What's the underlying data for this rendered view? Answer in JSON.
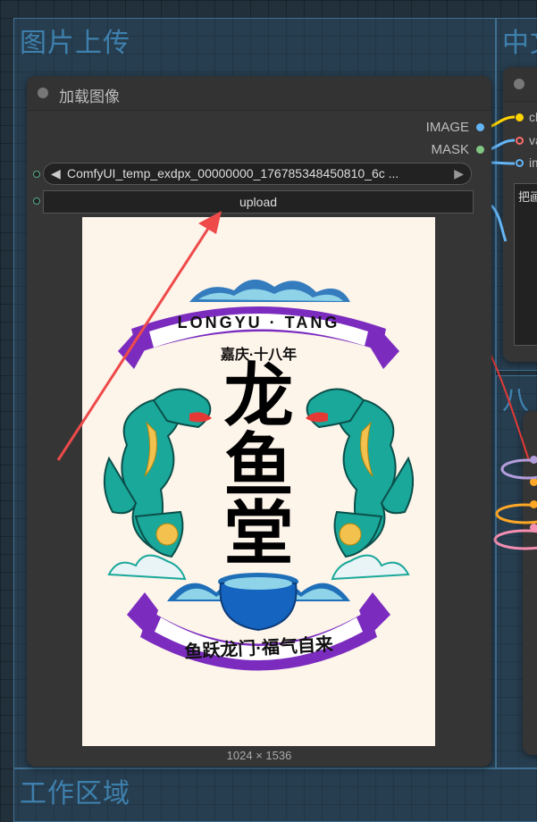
{
  "groups": {
    "upload_group_title": "图片上传",
    "chinese_group_title": "中文",
    "eight_group_title": "八",
    "workspace_group_title": "工作区域"
  },
  "load_image_node": {
    "title": "加载图像",
    "outputs": [
      {
        "label": "IMAGE",
        "color": "#64b5f6"
      },
      {
        "label": "MASK",
        "color": "#81c784"
      }
    ],
    "image_combo": {
      "value": "ComfyUI_temp_exdpx_00000000_176785348450810_6c ...",
      "left_arrow": "◀",
      "right_arrow": "▶"
    },
    "upload_label": "upload",
    "image_size": "1024 × 1536"
  },
  "poster": {
    "banner_top": "LONGYU · TANG",
    "subtitle": "嘉庆·十八年",
    "big_title_1": "龙",
    "big_title_2": "鱼",
    "big_title_3": "堂",
    "banner_bottom": "鱼跃龙门·福气自来"
  },
  "right_node": {
    "inputs": [
      {
        "label": "cli",
        "color": "#ffd400"
      },
      {
        "label": "va",
        "color": "#ff6b6b"
      },
      {
        "label": "im",
        "color": "#64b5f6"
      }
    ],
    "text_preview": "把画"
  },
  "colors": {
    "arrow": "#ee4a4a",
    "node_bg": "#353535",
    "group_title": "#3e80ad"
  }
}
